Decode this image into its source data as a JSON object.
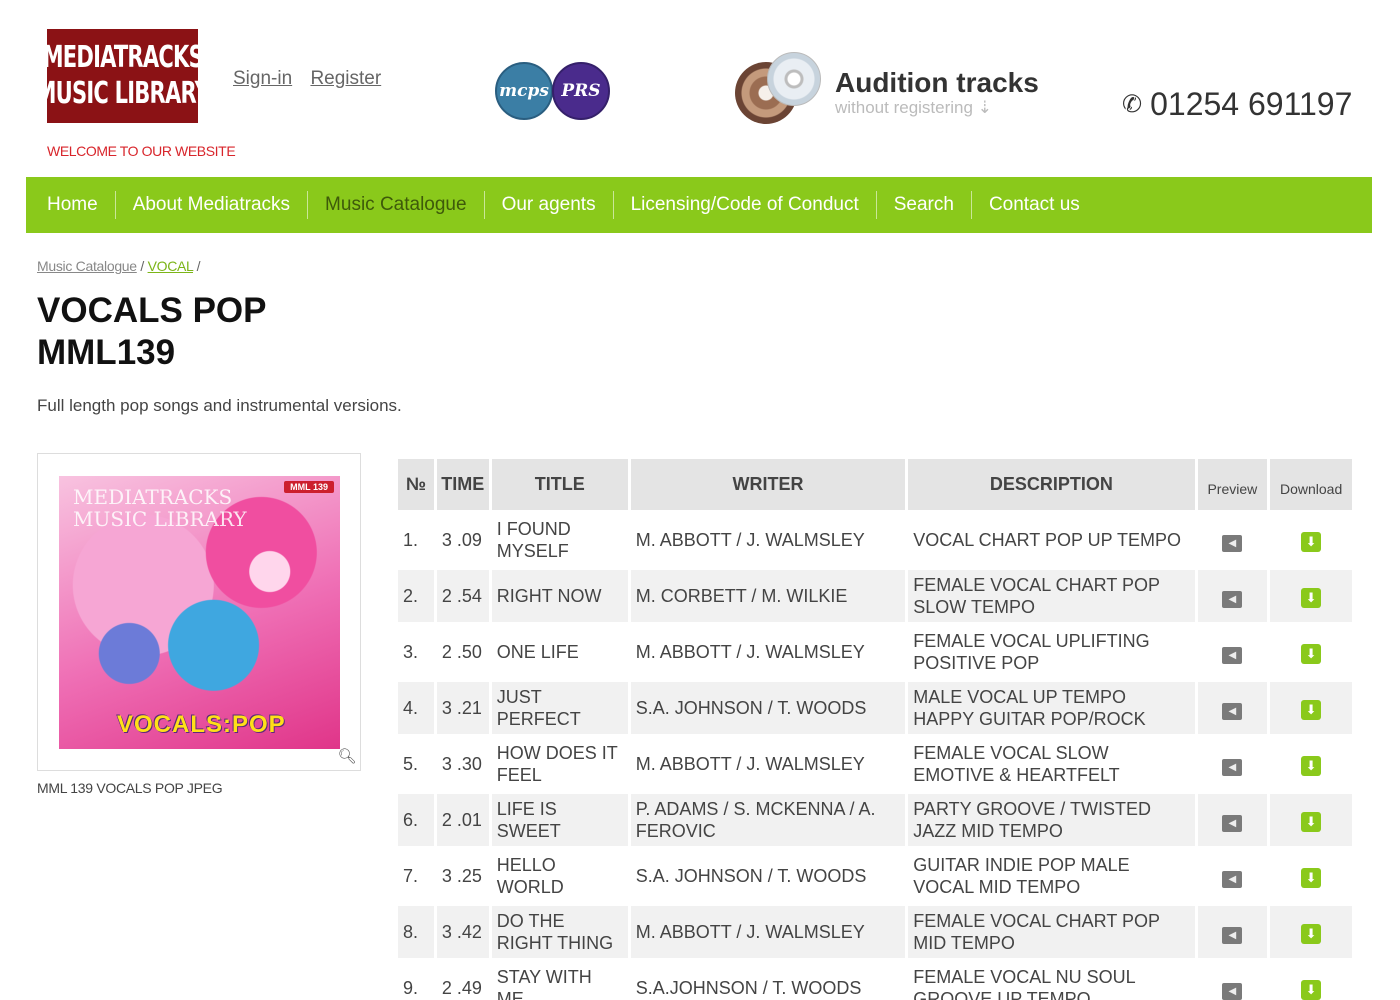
{
  "header": {
    "logo_line1": "MEDIATRACKS",
    "logo_line2": "MUSIC LIBRARY",
    "sign_in": "Sign-in",
    "register": "Register",
    "welcome": "WELCOME TO OUR WEBSITE",
    "badge_mcps": "mcps",
    "badge_prs": "PRS",
    "audition_title": "Audition tracks",
    "audition_sub": "without registering ⇣",
    "phone": "01254 691197",
    "phone_icon": "phone-icon"
  },
  "nav": {
    "items": [
      "Home",
      "About Mediatracks",
      "Music Catalogue",
      "Our agents",
      "Licensing/Code of Conduct",
      "Search",
      "Contact us"
    ],
    "active": "Music Catalogue"
  },
  "breadcrumb": {
    "root": "Music Catalogue",
    "category": "VOCAL",
    "sep": "/"
  },
  "album": {
    "title_line1": "VOCALS POP",
    "title_line2": "MML139",
    "description": "Full length pop songs and instrumental versions.",
    "cover_tag": "MML 139",
    "cover_mark_line1": "MEDIATRACKS",
    "cover_mark_line2": "MUSIC LIBRARY",
    "cover_title": "VOCALS:POP",
    "caption": "MML 139 VOCALS POP JPEG"
  },
  "table": {
    "headers": {
      "no": "№",
      "time": "TIME",
      "title": "TITLE",
      "writer": "WRITER",
      "description": "DESCRIPTION",
      "preview": "Preview",
      "download": "Download"
    },
    "rows": [
      {
        "no": "1.",
        "time": "3 .09",
        "title": "I FOUND MYSELF",
        "writer": "M. ABBOTT / J. WALMSLEY",
        "description": "VOCAL CHART POP UP TEMPO"
      },
      {
        "no": "2.",
        "time": "2 .54",
        "title": "RIGHT NOW",
        "writer": "M. CORBETT / M. WILKIE",
        "description": "FEMALE VOCAL CHART POP SLOW TEMPO"
      },
      {
        "no": "3.",
        "time": "2 .50",
        "title": "ONE LIFE",
        "writer": "M. ABBOTT / J. WALMSLEY",
        "description": "FEMALE VOCAL UPLIFTING POSITIVE POP"
      },
      {
        "no": "4.",
        "time": "3 .21",
        "title": "JUST PERFECT",
        "writer": "S.A. JOHNSON / T. WOODS",
        "description": "MALE VOCAL UP TEMPO HAPPY GUITAR POP/ROCK"
      },
      {
        "no": "5.",
        "time": "3 .30",
        "title": "HOW DOES IT FEEL",
        "writer": "M. ABBOTT / J. WALMSLEY",
        "description": "FEMALE VOCAL SLOW EMOTIVE & HEARTFELT"
      },
      {
        "no": "6.",
        "time": "2 .01",
        "title": "LIFE IS SWEET",
        "writer": "P. ADAMS / S. McKENNA / A. FEROVIC",
        "description": "PARTY GROOVE / TWISTED JAZZ MID TEMPO"
      },
      {
        "no": "7.",
        "time": "3 .25",
        "title": "HELLO WORLD",
        "writer": "S.A. JOHNSON / T. WOODS",
        "description": "GUITAR INDIE POP MALE VOCAL MID TEMPO"
      },
      {
        "no": "8.",
        "time": "3 .42",
        "title": "DO THE RIGHT THING",
        "writer": "M. ABBOTT / J. WALMSLEY",
        "description": "FEMALE VOCAL CHART POP MID TEMPO"
      },
      {
        "no": "9.",
        "time": "2 .49",
        "title": "STAY WITH ME",
        "writer": "S.A.JOHNSON / T. WOODS",
        "description": "FEMALE VOCAL NU SOUL GROOVE UP TEMPO"
      }
    ]
  },
  "colors": {
    "brand_red": "#8b1215",
    "nav_green": "#8ac91b",
    "welcome_red": "#d8252b"
  }
}
